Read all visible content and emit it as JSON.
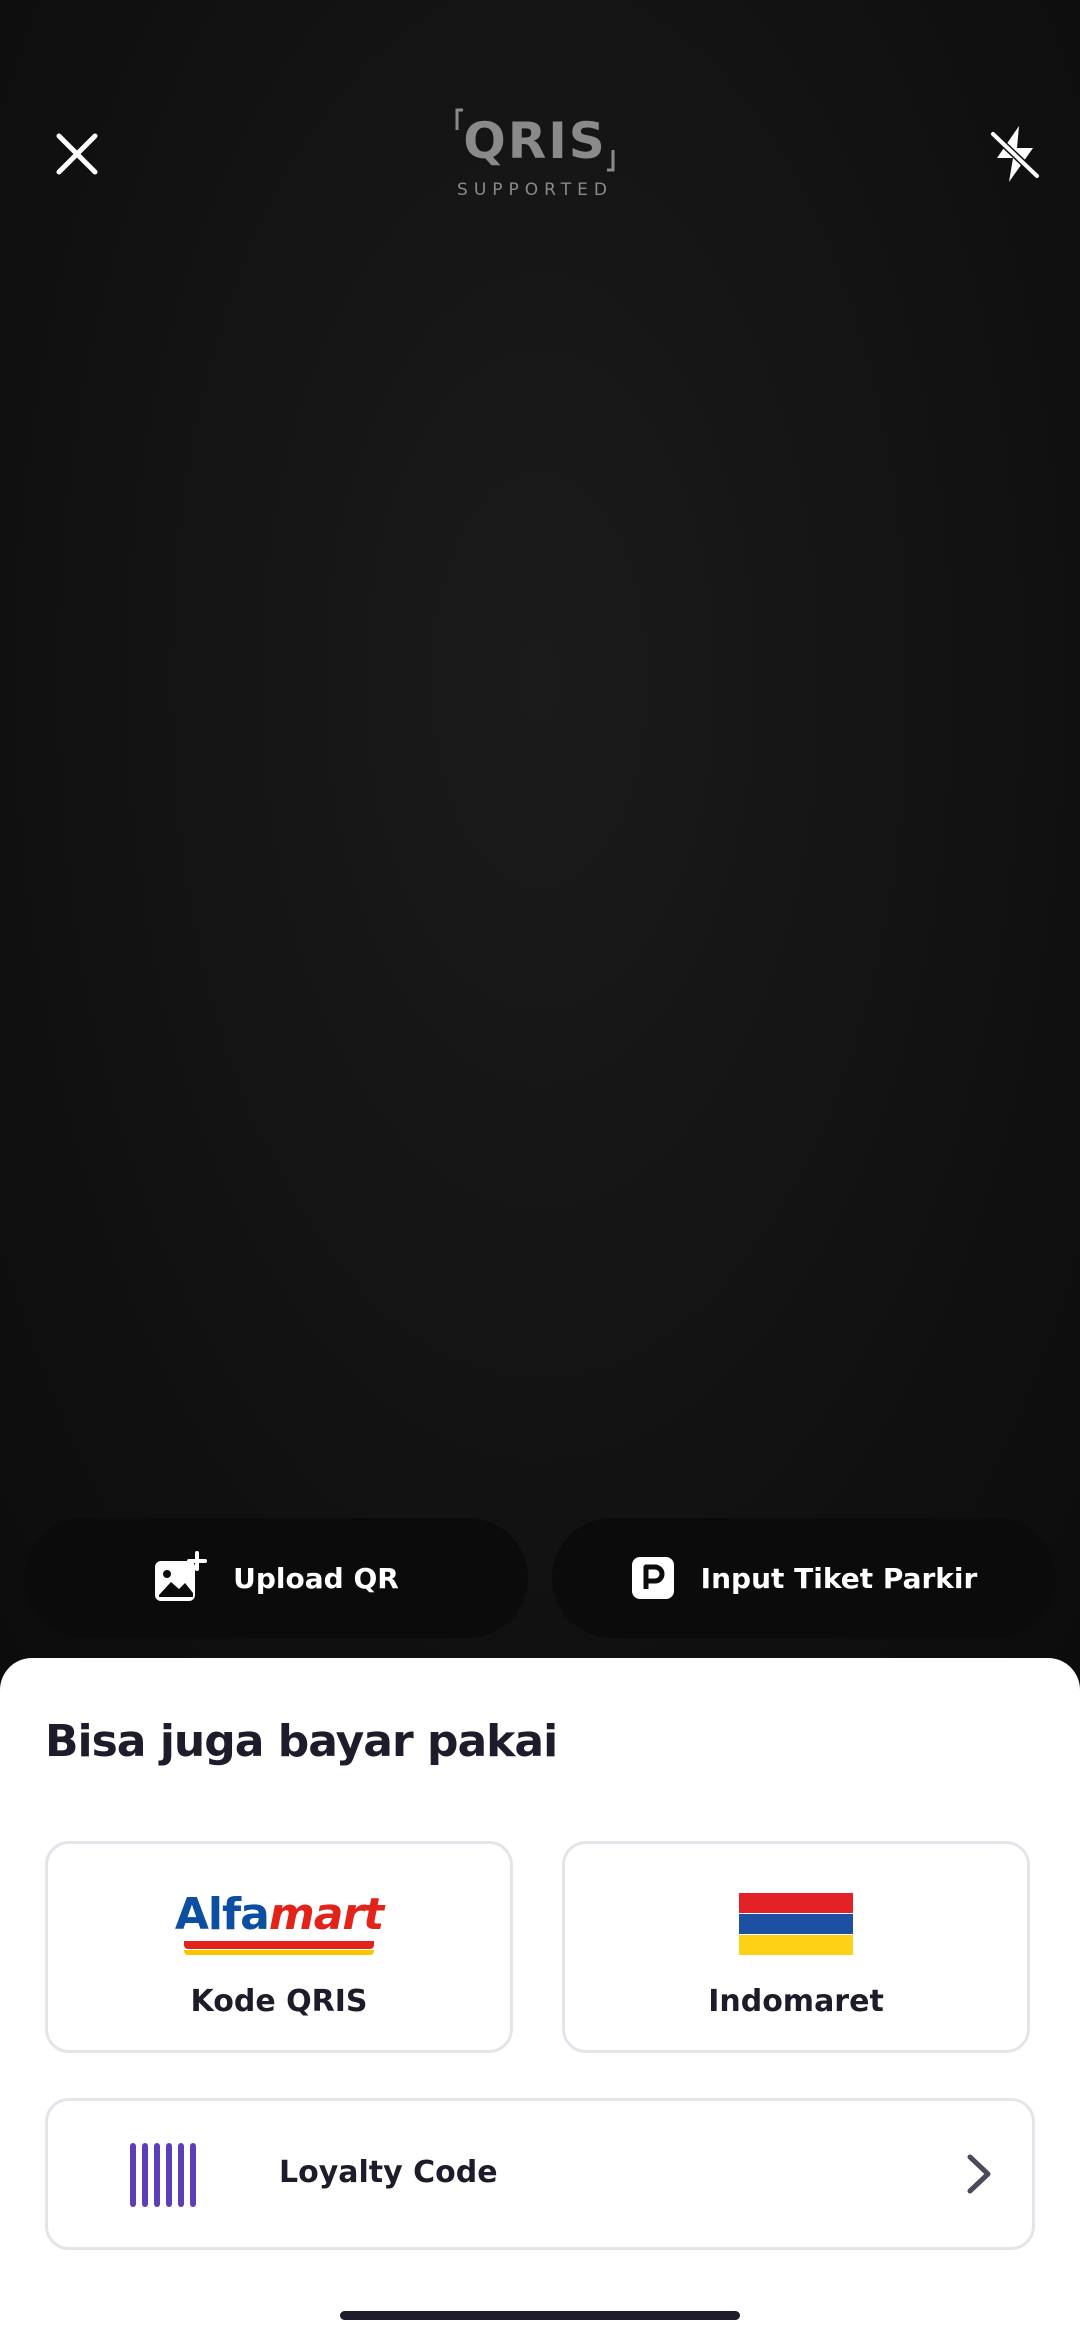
{
  "header": {
    "logo_name": "QRIS",
    "logo_tagline": "SUPPORTED",
    "close_icon": "close-icon",
    "flash_icon": "flash-off-icon"
  },
  "actions": {
    "upload_label": "Upload QR",
    "upload_icon": "image-add-icon",
    "ticket_label": "Input Tiket Parkir",
    "ticket_icon": "parking-icon"
  },
  "sheet": {
    "title": "Bisa juga bayar pakai",
    "options": [
      {
        "logo_text_blue": "Alfa",
        "logo_text_red": "mart",
        "label": "Kode QRIS"
      },
      {
        "label": "Indomaret"
      }
    ],
    "loyalty": {
      "label": "Loyalty Code",
      "icon": "barcode-icon"
    }
  },
  "colors": {
    "sheet_bg": "#ffffff",
    "text_dark": "#1e1c2a",
    "loyalty_purple": "#5b3eb8",
    "alfamart_blue": "#0b4ea2",
    "alfamart_red": "#e2231a",
    "indomaret_red": "#e32227",
    "indomaret_blue": "#1d4fa3",
    "indomaret_yellow": "#fcd116"
  }
}
